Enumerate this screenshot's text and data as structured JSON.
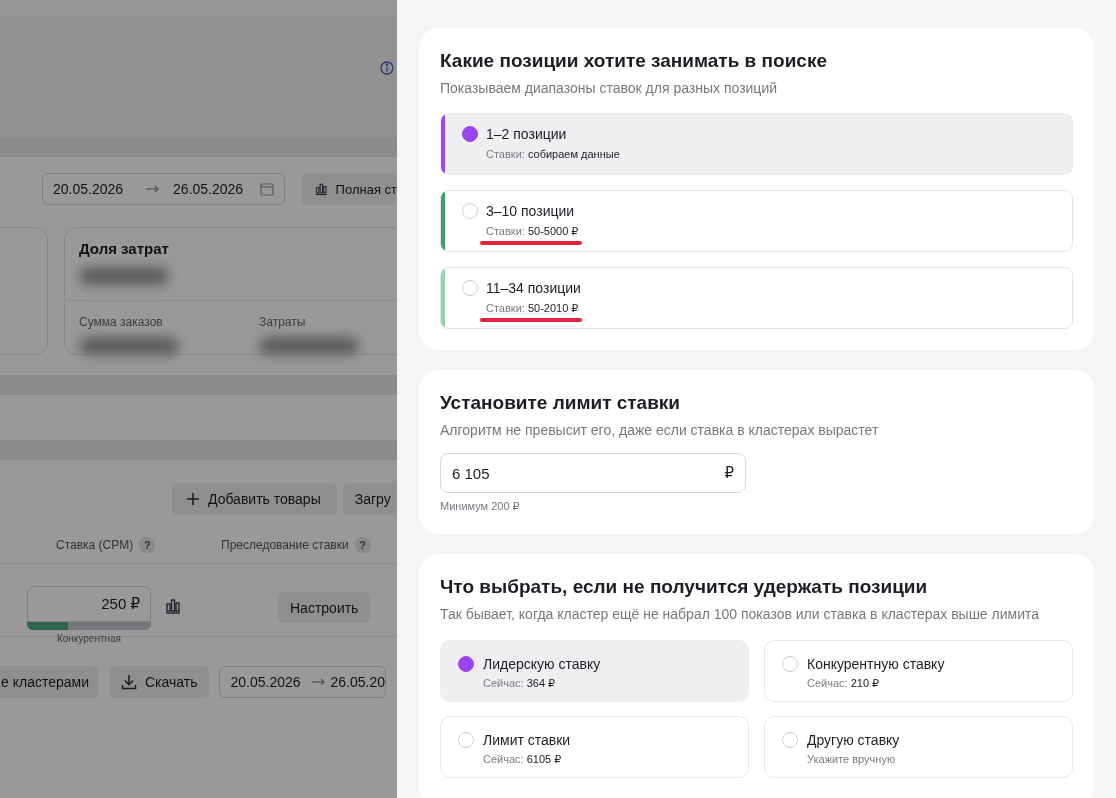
{
  "background_page": {
    "date_range": {
      "from": "20.05.2026",
      "to": "26.05.2026"
    },
    "full_stats_button": "Полная ст",
    "cost_share_card": {
      "title": "Доля затрат",
      "metrics": [
        "Сумма заказов",
        "Затраты"
      ]
    },
    "add_products_button": "Добавить товары",
    "upload_button": "Загру",
    "table": {
      "columns": [
        {
          "label": "Ставка (CPM)",
          "help": "?"
        },
        {
          "label": "Преследование ставки",
          "help": "?"
        }
      ],
      "row": {
        "bid": "250 ₽",
        "level": 0.33,
        "bid_type": "Конкурентная",
        "action": "Настроить"
      }
    },
    "toolbar": {
      "clusters_button": "е кластерами",
      "download_button": "Скачать",
      "date_range": {
        "from": "20.05.2026",
        "to": "26.05.20"
      }
    }
  },
  "drawer": {
    "position_card": {
      "title": "Какие позиции хотите занимать в поиске",
      "subtitle": "Показываем диапазоны ставок для разных позиций",
      "options": [
        {
          "label": "1–2 позиции",
          "rates_label": "Ставки:",
          "rates_value": "собираем данные",
          "selected": true,
          "color": "#a048f0",
          "underlined": false
        },
        {
          "label": "3–10 позиции",
          "rates_label": "Ставки:",
          "rates_value": "50-5000 ₽",
          "selected": false,
          "color": "#3a9f68",
          "underlined": true
        },
        {
          "label": "11–34 позиции",
          "rates_label": "Ставки:",
          "rates_value": "50-2010 ₽",
          "selected": false,
          "color": "#92d5ac",
          "underlined": true
        }
      ]
    },
    "limit_card": {
      "title": "Установите лимит ставки",
      "subtitle": "Алгоритм не превысит его, даже если ставка в кластерах вырастет",
      "value": "6 105",
      "currency": "₽",
      "hint": "Минимум 200 ₽"
    },
    "fallback_card": {
      "title": "Что выбрать, если не получится удержать позиции",
      "subtitle": "Так бывает, когда кластер ещё не набрал 100 показов или ставка в кластерах выше лимита",
      "options": [
        {
          "kind": "value",
          "label": "Лидерскую ставку",
          "note_label": "Сейчас:",
          "note_value": "364 ₽",
          "selected": true
        },
        {
          "kind": "value",
          "label": "Конкурентную ставку",
          "note_label": "Сейчас:",
          "note_value": "210 ₽",
          "selected": false
        },
        {
          "kind": "value",
          "label": "Лимит ставки",
          "note_label": "Сейчас:",
          "note_value": "6105 ₽",
          "selected": false
        },
        {
          "kind": "manual",
          "label": "Другую ставку",
          "hint": "Укажите вручную",
          "selected": false
        }
      ]
    }
  }
}
